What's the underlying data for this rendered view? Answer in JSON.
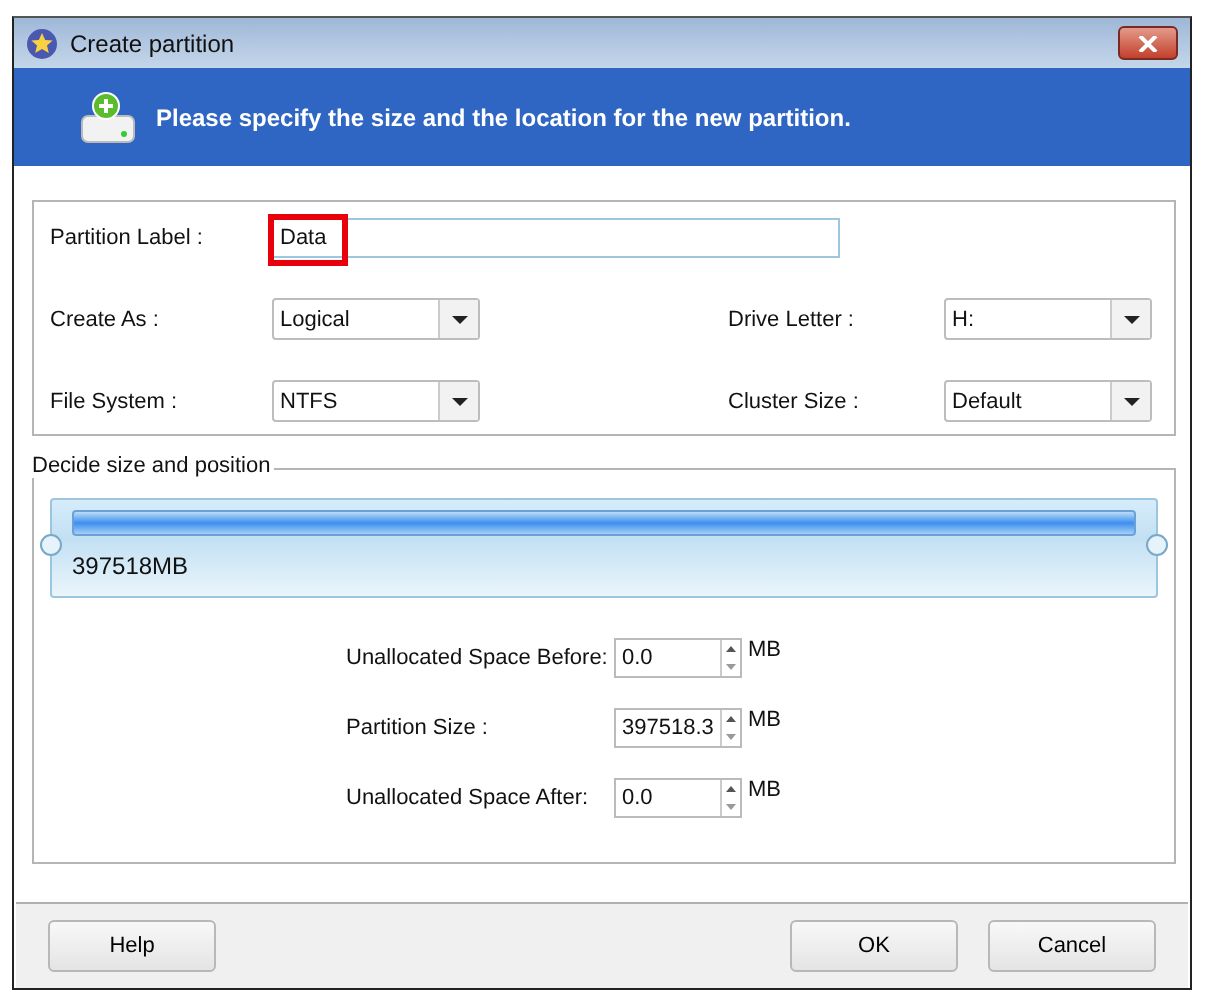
{
  "window": {
    "title": "Create partition"
  },
  "banner": {
    "text": "Please specify the size and the location for the new partition."
  },
  "partition_label": {
    "label": "Partition Label :",
    "value": "Data",
    "highlighted": true
  },
  "options": [
    {
      "label": "Create As :",
      "value": "Logical"
    },
    {
      "label": "Drive Letter :",
      "value": "H:"
    },
    {
      "label": "File System :",
      "value": "NTFS"
    },
    {
      "label": "Cluster Size :",
      "value": "Default"
    }
  ],
  "size_position": {
    "title": "Decide size and position",
    "size": "397518MB",
    "level": 1,
    "spins": [
      {
        "label": "Unallocated Space Before:",
        "value": "0.0",
        "unit": "MB"
      },
      {
        "label": "Partition Size :",
        "value": "397518.3",
        "unit": "MB"
      },
      {
        "label": "Unallocated Space After:",
        "value": "0.0",
        "unit": "MB"
      }
    ]
  },
  "buttons": [
    {
      "label": "Help"
    },
    {
      "label": "OK"
    },
    {
      "label": "Cancel"
    }
  ]
}
